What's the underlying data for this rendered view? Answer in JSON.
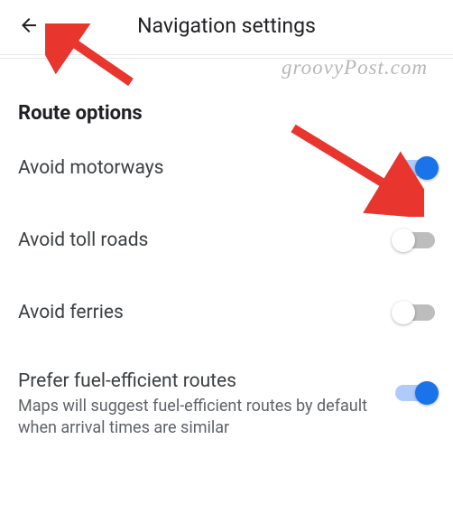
{
  "header": {
    "title": "Navigation settings"
  },
  "watermark": "groovyPost.com",
  "section": {
    "title": "Route options"
  },
  "rows": [
    {
      "label": "Avoid motorways",
      "enabled": true
    },
    {
      "label": "Avoid toll roads",
      "enabled": false
    },
    {
      "label": "Avoid ferries",
      "enabled": false
    },
    {
      "label": "Prefer fuel-efficient routes",
      "sublabel": "Maps will suggest fuel-efficient routes by default when arrival times are similar",
      "enabled": true
    }
  ],
  "annotation_color": "#e8352e"
}
